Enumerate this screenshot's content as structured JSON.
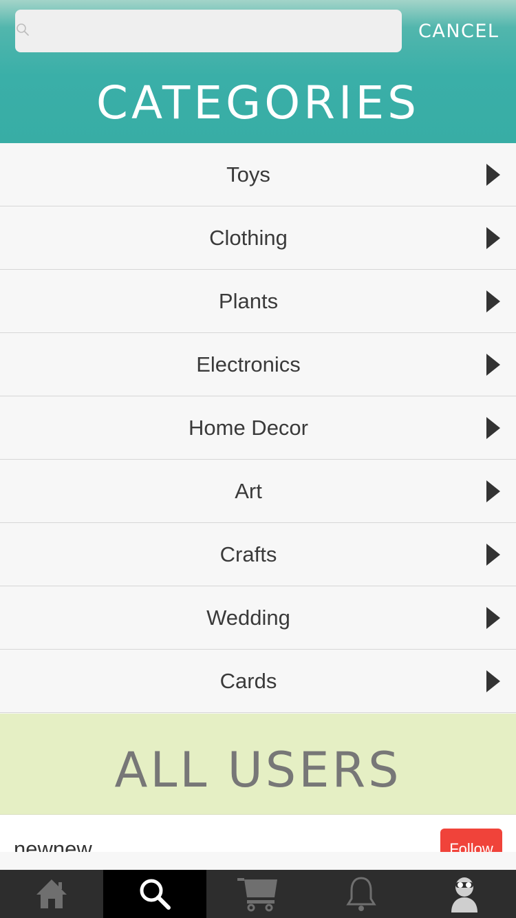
{
  "search": {
    "value": "",
    "placeholder": "",
    "cancel_label": "CANCEL"
  },
  "header": {
    "title": "CATEGORIES"
  },
  "categories": [
    "Toys",
    "Clothing",
    "Plants",
    "Electronics",
    "Home Decor",
    "Art",
    "Crafts",
    "Wedding",
    "Cards"
  ],
  "users": {
    "title": "ALL USERS",
    "items": [
      {
        "username": "newnew",
        "follow_label": "Follow"
      }
    ]
  },
  "tabbar": {
    "active": "search",
    "tabs": [
      {
        "icon": "home-icon"
      },
      {
        "icon": "search-icon"
      },
      {
        "icon": "cart-icon"
      },
      {
        "icon": "bell-icon"
      },
      {
        "icon": "profile-avatar-icon"
      }
    ]
  },
  "colors": {
    "header_teal": "#3aafa8",
    "users_band": "#e5efc4",
    "follow_red": "#f0433a",
    "tabbar_bg": "#2d2d2d"
  }
}
